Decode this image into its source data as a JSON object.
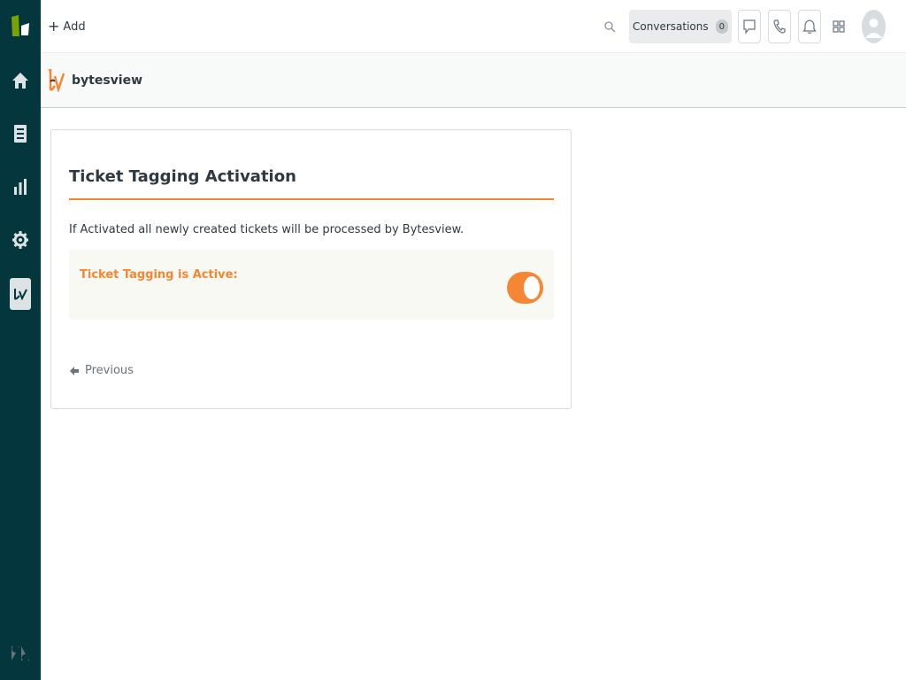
{
  "colors": {
    "sidebar_bg": "#03363d",
    "accent": "#f58634",
    "brand_green": "#78a300"
  },
  "sidebar": {
    "items": [
      {
        "name": "zendesk-support-logo-icon"
      },
      {
        "name": "home-icon"
      },
      {
        "name": "views-icon"
      },
      {
        "name": "reporting-icon"
      },
      {
        "name": "admin-gear-icon"
      },
      {
        "name": "bytesview-app-icon"
      },
      {
        "name": "zendesk-logo-icon"
      }
    ]
  },
  "header": {
    "add_label": "Add",
    "conversations_label": "Conversations",
    "conversations_count": "0",
    "icons": [
      "search-icon",
      "chat-icon",
      "phone-icon",
      "bell-icon",
      "products-grid-icon",
      "avatar-icon"
    ]
  },
  "app": {
    "brand_name": "bytesview"
  },
  "card": {
    "title": "Ticket Tagging Activation",
    "description": "If Activated all newly created tickets will be processed by Bytesview.",
    "status_label": "Ticket Tagging is Active:",
    "toggle_on": true,
    "previous_label": "Previous"
  }
}
